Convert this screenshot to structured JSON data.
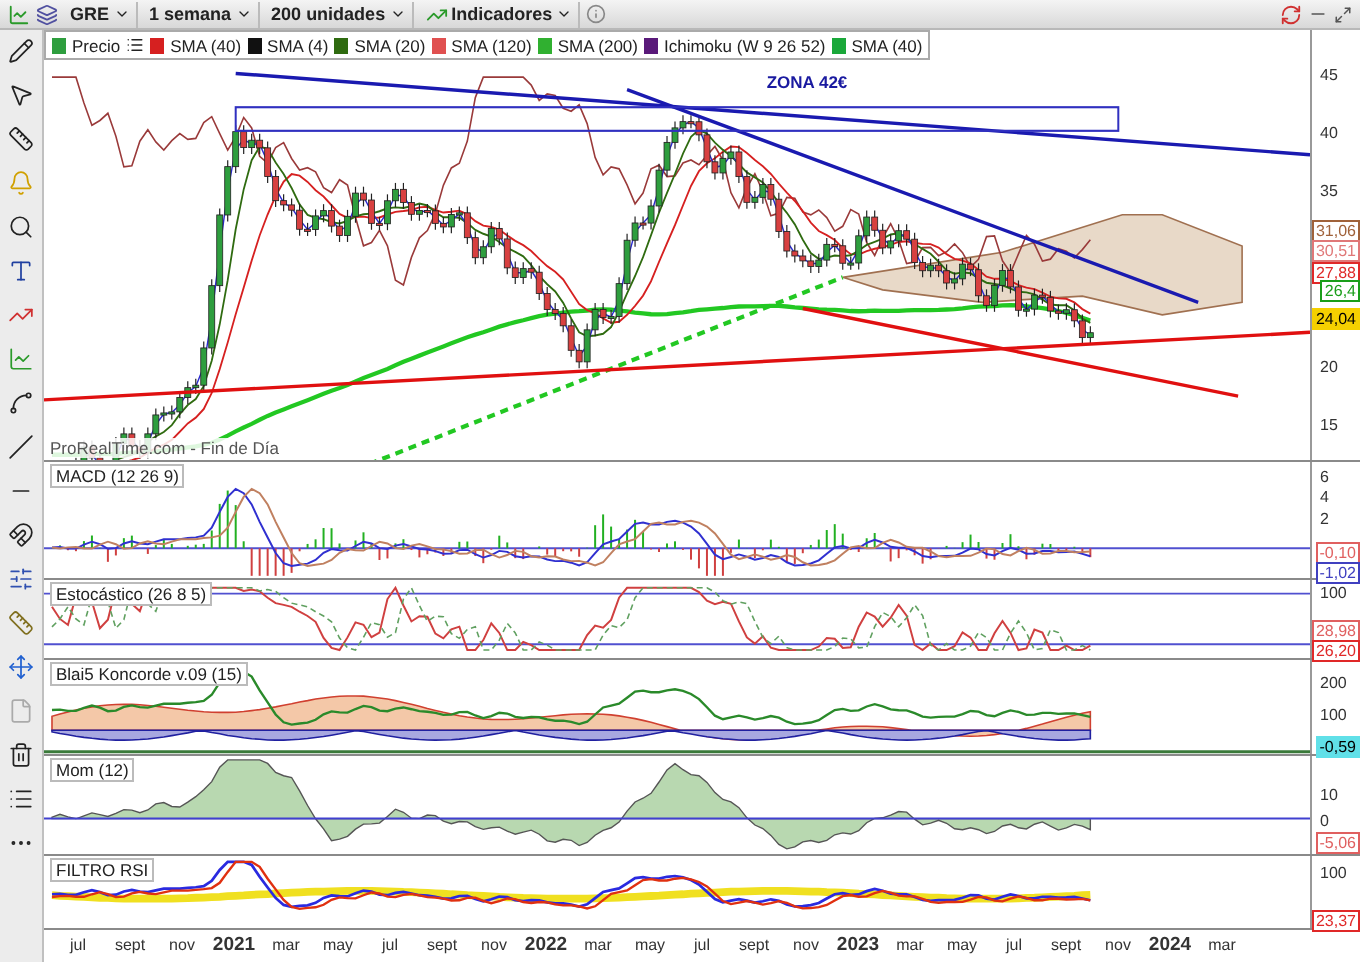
{
  "toolbar": {
    "instrument": "GRE",
    "period": "1 semana",
    "units": "200 unidades",
    "indicators": "Indicadores"
  },
  "legend": [
    {
      "label": "Precio",
      "color": "#2e9e3e"
    },
    {
      "label": "SMA (40)",
      "color": "#d62020"
    },
    {
      "label": "SMA (4)",
      "color": "#111111"
    },
    {
      "label": "SMA (20)",
      "color": "#2f6b10"
    },
    {
      "label": "SMA (120)",
      "color": "#e05050"
    },
    {
      "label": "SMA (200)",
      "color": "#30b030"
    },
    {
      "label": "Ichimoku (W 9 26 52)",
      "color": "#5a1a7a"
    },
    {
      "label": "SMA (40)",
      "color": "#1aa83a"
    }
  ],
  "price_panel": {
    "annotation": "ZONA 42€",
    "watermark": "ProRealTime.com - Fin de Día",
    "axis_ticks": [
      "45",
      "40",
      "35",
      "20",
      "15"
    ],
    "badges": [
      {
        "text": "31,06",
        "color": "#a0623a",
        "kind": "outlined"
      },
      {
        "text": "30,51",
        "color": "#e07878",
        "kind": "outlined"
      },
      {
        "text": "27,88",
        "color": "#e02828",
        "kind": "outlined"
      },
      {
        "text": "26,4",
        "color": "#1a9e1a",
        "kind": "outlined"
      },
      {
        "text": "24,04",
        "color": "#f5d000",
        "kind": "filled"
      }
    ]
  },
  "panels": [
    {
      "kind": "macd",
      "title": "MACD (12 26 9)",
      "axis_ticks": [
        "6",
        "4",
        "2"
      ],
      "badges": [
        {
          "text": "-0,10",
          "color": "#e06060",
          "kind": "outlined"
        },
        {
          "text": "-1,02",
          "color": "#4040c0",
          "kind": "outlined"
        }
      ]
    },
    {
      "kind": "stochastic",
      "title": "Estocástico (26 8 5)",
      "axis_ticks": [
        "100"
      ],
      "badges": [
        {
          "text": "28,98",
          "color": "#e06060",
          "kind": "outlined"
        },
        {
          "text": "26,20",
          "color": "#e02828",
          "kind": "outlined"
        }
      ]
    },
    {
      "kind": "koncorde",
      "title": "Blai5 Koncorde v.09 (15)",
      "axis_ticks": [
        "200",
        "100"
      ],
      "badges": [
        {
          "text": "-0,59",
          "color": "#60e0e8",
          "kind": "filled"
        }
      ]
    },
    {
      "kind": "momentum",
      "title": "Mom (12)",
      "axis_ticks": [
        "10",
        "0"
      ],
      "badges": [
        {
          "text": "-5,06",
          "color": "#e06060",
          "kind": "outlined"
        }
      ]
    },
    {
      "kind": "rsi",
      "title": "FILTRO RSI",
      "axis_ticks": [
        "100"
      ],
      "badges": [
        {
          "text": "23,37",
          "color": "#e02828",
          "kind": "outlined"
        }
      ]
    }
  ],
  "x_axis": [
    {
      "label": "jul",
      "kind": "month"
    },
    {
      "label": "sept",
      "kind": "month"
    },
    {
      "label": "nov",
      "kind": "month"
    },
    {
      "label": "2021",
      "kind": "year"
    },
    {
      "label": "mar",
      "kind": "month"
    },
    {
      "label": "may",
      "kind": "month"
    },
    {
      "label": "jul",
      "kind": "month"
    },
    {
      "label": "sept",
      "kind": "month"
    },
    {
      "label": "nov",
      "kind": "month"
    },
    {
      "label": "2022",
      "kind": "year"
    },
    {
      "label": "mar",
      "kind": "month"
    },
    {
      "label": "may",
      "kind": "month"
    },
    {
      "label": "jul",
      "kind": "month"
    },
    {
      "label": "sept",
      "kind": "month"
    },
    {
      "label": "nov",
      "kind": "month"
    },
    {
      "label": "2023",
      "kind": "year"
    },
    {
      "label": "mar",
      "kind": "month"
    },
    {
      "label": "may",
      "kind": "month"
    },
    {
      "label": "jul",
      "kind": "month"
    },
    {
      "label": "sept",
      "kind": "month"
    },
    {
      "label": "nov",
      "kind": "month"
    },
    {
      "label": "2024",
      "kind": "year"
    },
    {
      "label": "mar",
      "kind": "month"
    }
  ]
}
